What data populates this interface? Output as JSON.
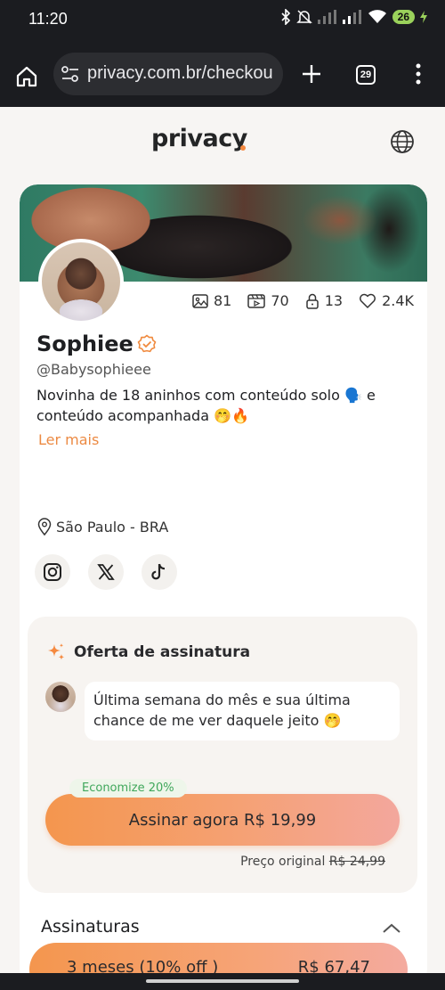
{
  "status": {
    "time": "11:20",
    "battery": "26"
  },
  "browser": {
    "url": "privacy.com.br/checkou",
    "tab_count": "29"
  },
  "site": {
    "logo": "privacy"
  },
  "profile": {
    "stats": {
      "photos": "81",
      "videos": "70",
      "locked": "13",
      "likes": "2.4K"
    },
    "name": "Sophiee",
    "handle": "@Babysophieee",
    "bio": "Novinha de 18 aninhos com conteúdo solo 🗣️ e conteúdo acompanhada 🤭🔥",
    "read_more": "Ler mais",
    "location": "São Paulo - BRA"
  },
  "offer": {
    "title": "Oferta de assinatura",
    "message": "Última semana do mês e sua última chance de me ver daquele jeito 🤭",
    "badge": "Economize 20%",
    "cta": "Assinar agora R$ 19,99",
    "original_label": "Preço original",
    "original_price": "R$ 24,99"
  },
  "subscriptions": {
    "title": "Assinaturas",
    "plans": [
      {
        "label": "3 meses (10% off )",
        "price": "R$ 67,47"
      }
    ]
  },
  "colors": {
    "accent": "#f5893f",
    "link": "#ec8a43",
    "badge_text": "#3fa75b"
  }
}
